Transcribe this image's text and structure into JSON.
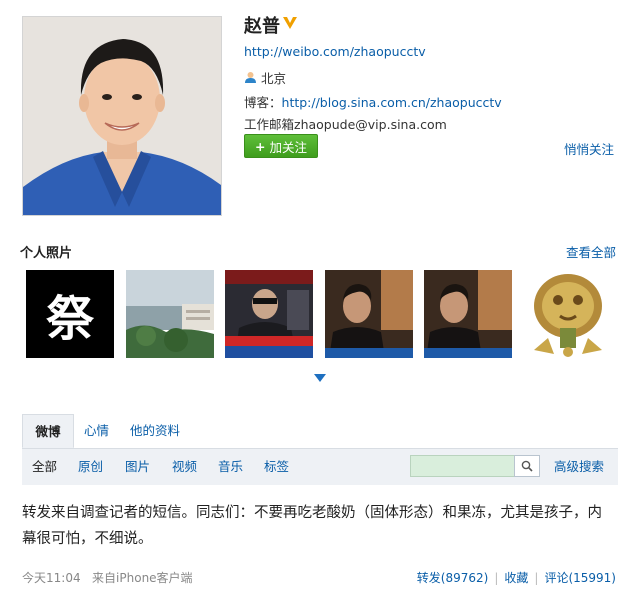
{
  "profile": {
    "name": "赵普",
    "weibo_url": "http://weibo.com/zhaopucctv",
    "location": "北京",
    "blog_label": "博客：",
    "blog_url": "http://blog.sina.com.cn/zhaopucctv",
    "email_label": "工作邮箱",
    "email": "zhaopude@vip.sina.com",
    "follow_button": "加关注",
    "unfollow_link": "悄悄关注",
    "verified_icon": "verified-v-badge",
    "location_icon": "person-icon"
  },
  "photos": {
    "title": "个人照片",
    "view_all": "查看全部",
    "first_thumb_char": "祭",
    "expand_icon": "chevron-down-icon"
  },
  "tabs": [
    {
      "label": "微博"
    },
    {
      "label": "心情"
    },
    {
      "label": "他的资料"
    }
  ],
  "filters": [
    {
      "label": "全部"
    },
    {
      "label": "原创"
    },
    {
      "label": "图片"
    },
    {
      "label": "视频"
    },
    {
      "label": "音乐"
    },
    {
      "label": "标签"
    }
  ],
  "search": {
    "placeholder": "",
    "icon": "search-icon",
    "advanced": "高级搜索"
  },
  "post": {
    "text": "转发来自调查记者的短信。同志们：不要再吃老酸奶（固体形态）和果冻，尤其是孩子，内幕很可怕，不细说。",
    "time": "今天11:04",
    "source": "来自iPhone客户端",
    "repost": "转发(89762)",
    "favorite": "收藏",
    "comment": "评论(15991)"
  },
  "colors": {
    "link": "#0a5ea8",
    "follow_green": "#4caf2a",
    "tab_bg": "#eef1f5",
    "verified_orange": "#f0a000"
  }
}
